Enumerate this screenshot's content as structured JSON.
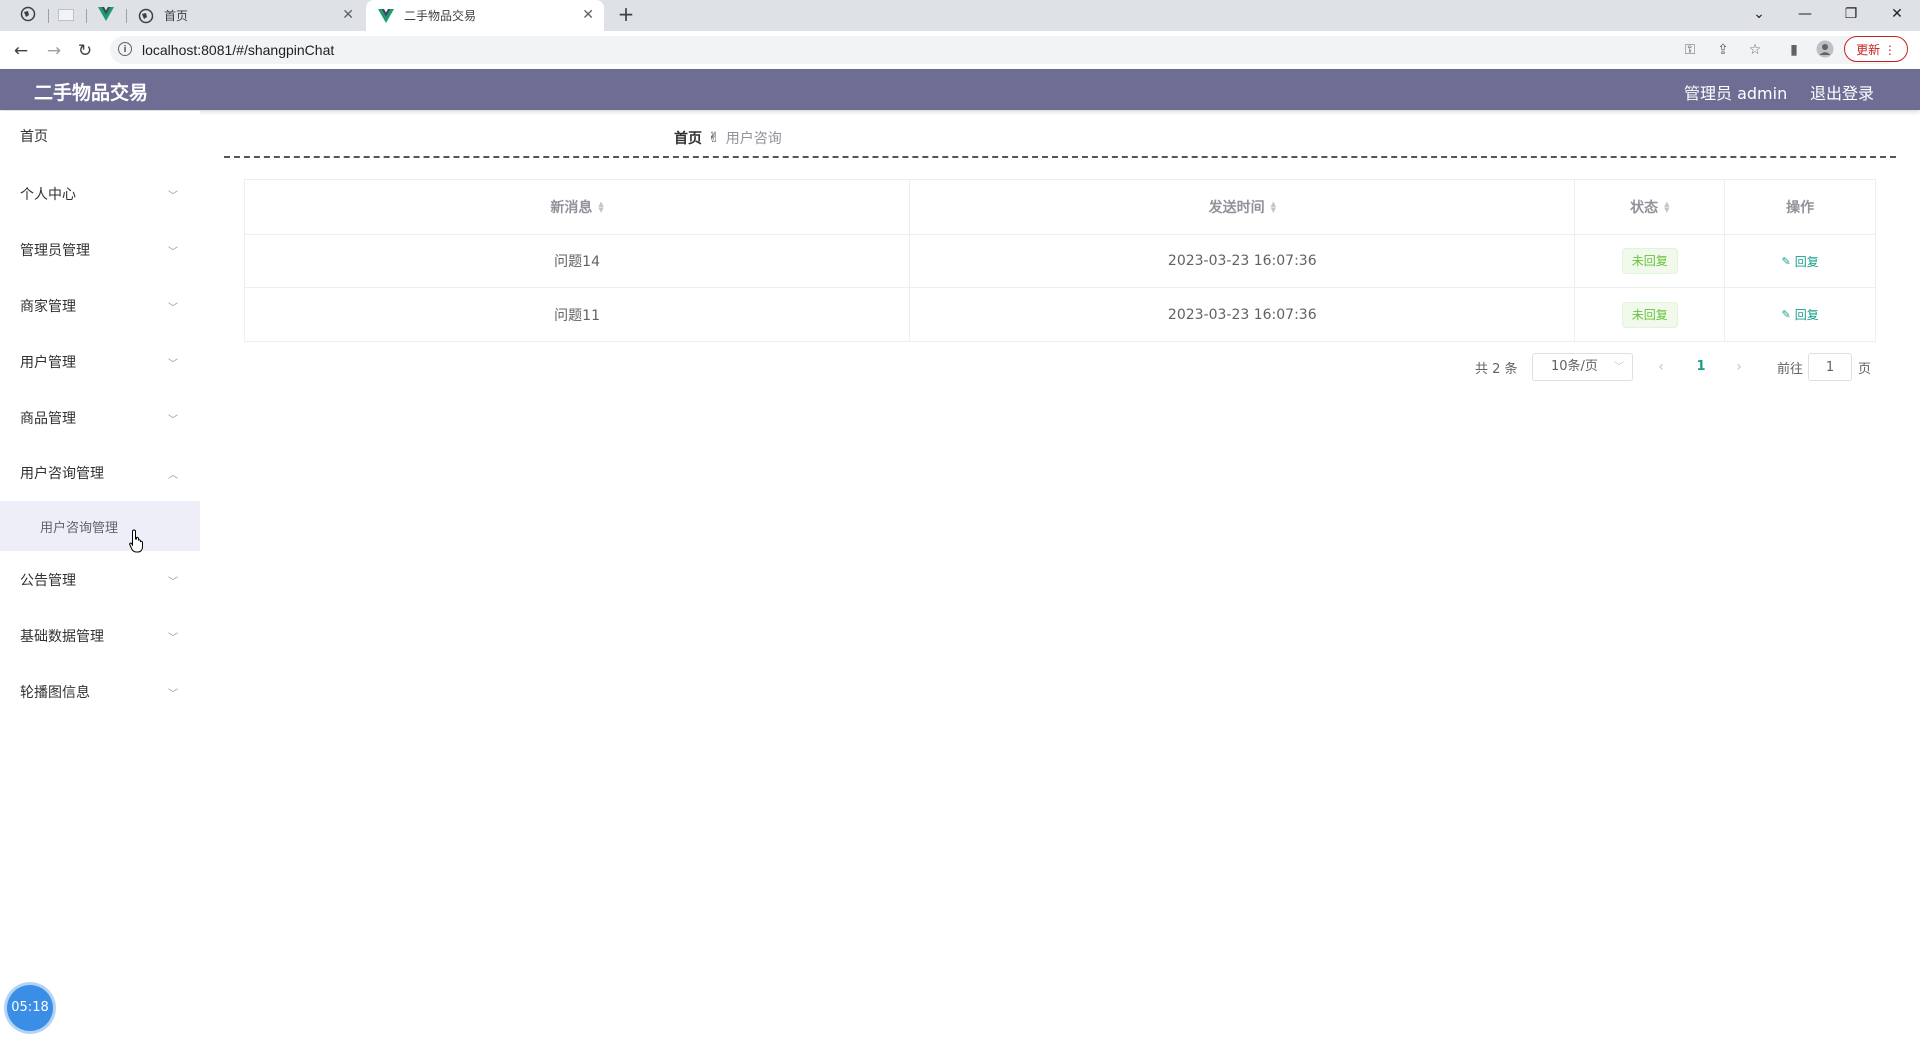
{
  "browser": {
    "tabs": [
      {
        "title": "首页",
        "icon": "globe-icon"
      },
      {
        "title": "二手物品交易",
        "icon": "vue-icon",
        "active": true
      }
    ],
    "url": "localhost:8081/#/shangpinChat",
    "update_label": "更新"
  },
  "header": {
    "app_title": "二手物品交易",
    "admin_label": "管理员 admin",
    "logout_label": "退出登录"
  },
  "sidebar": {
    "items": [
      {
        "label": "首页"
      },
      {
        "label": "个人中心"
      },
      {
        "label": "管理员管理"
      },
      {
        "label": "商家管理"
      },
      {
        "label": "用户管理"
      },
      {
        "label": "商品管理"
      },
      {
        "label": "用户咨询管理",
        "expanded": true
      },
      {
        "label": "公告管理"
      },
      {
        "label": "基础数据管理"
      },
      {
        "label": "轮播图信息"
      }
    ],
    "subitem": "用户咨询管理"
  },
  "breadcrumb": {
    "home": "首页",
    "current": "用户咨询"
  },
  "table": {
    "headers": [
      "新消息",
      "发送时间",
      "状态",
      "操作"
    ],
    "rows": [
      {
        "message": "问题14",
        "time": "2023-03-23 16:07:36",
        "status": "未回复",
        "action": "回复"
      },
      {
        "message": "问题11",
        "time": "2023-03-23 16:07:36",
        "status": "未回复",
        "action": "回复"
      }
    ]
  },
  "pagination": {
    "total": "共 2 条",
    "page_size": "10条/页",
    "current_page": "1",
    "goto_prefix": "前往",
    "goto_value": "1",
    "goto_suffix": "页"
  },
  "timer": "05:18",
  "colors": {
    "header_bg": "#6e6d94",
    "accent": "#1a9e8b",
    "tag_green": "#67c23a",
    "submenu_bg": "#eeeef8"
  }
}
